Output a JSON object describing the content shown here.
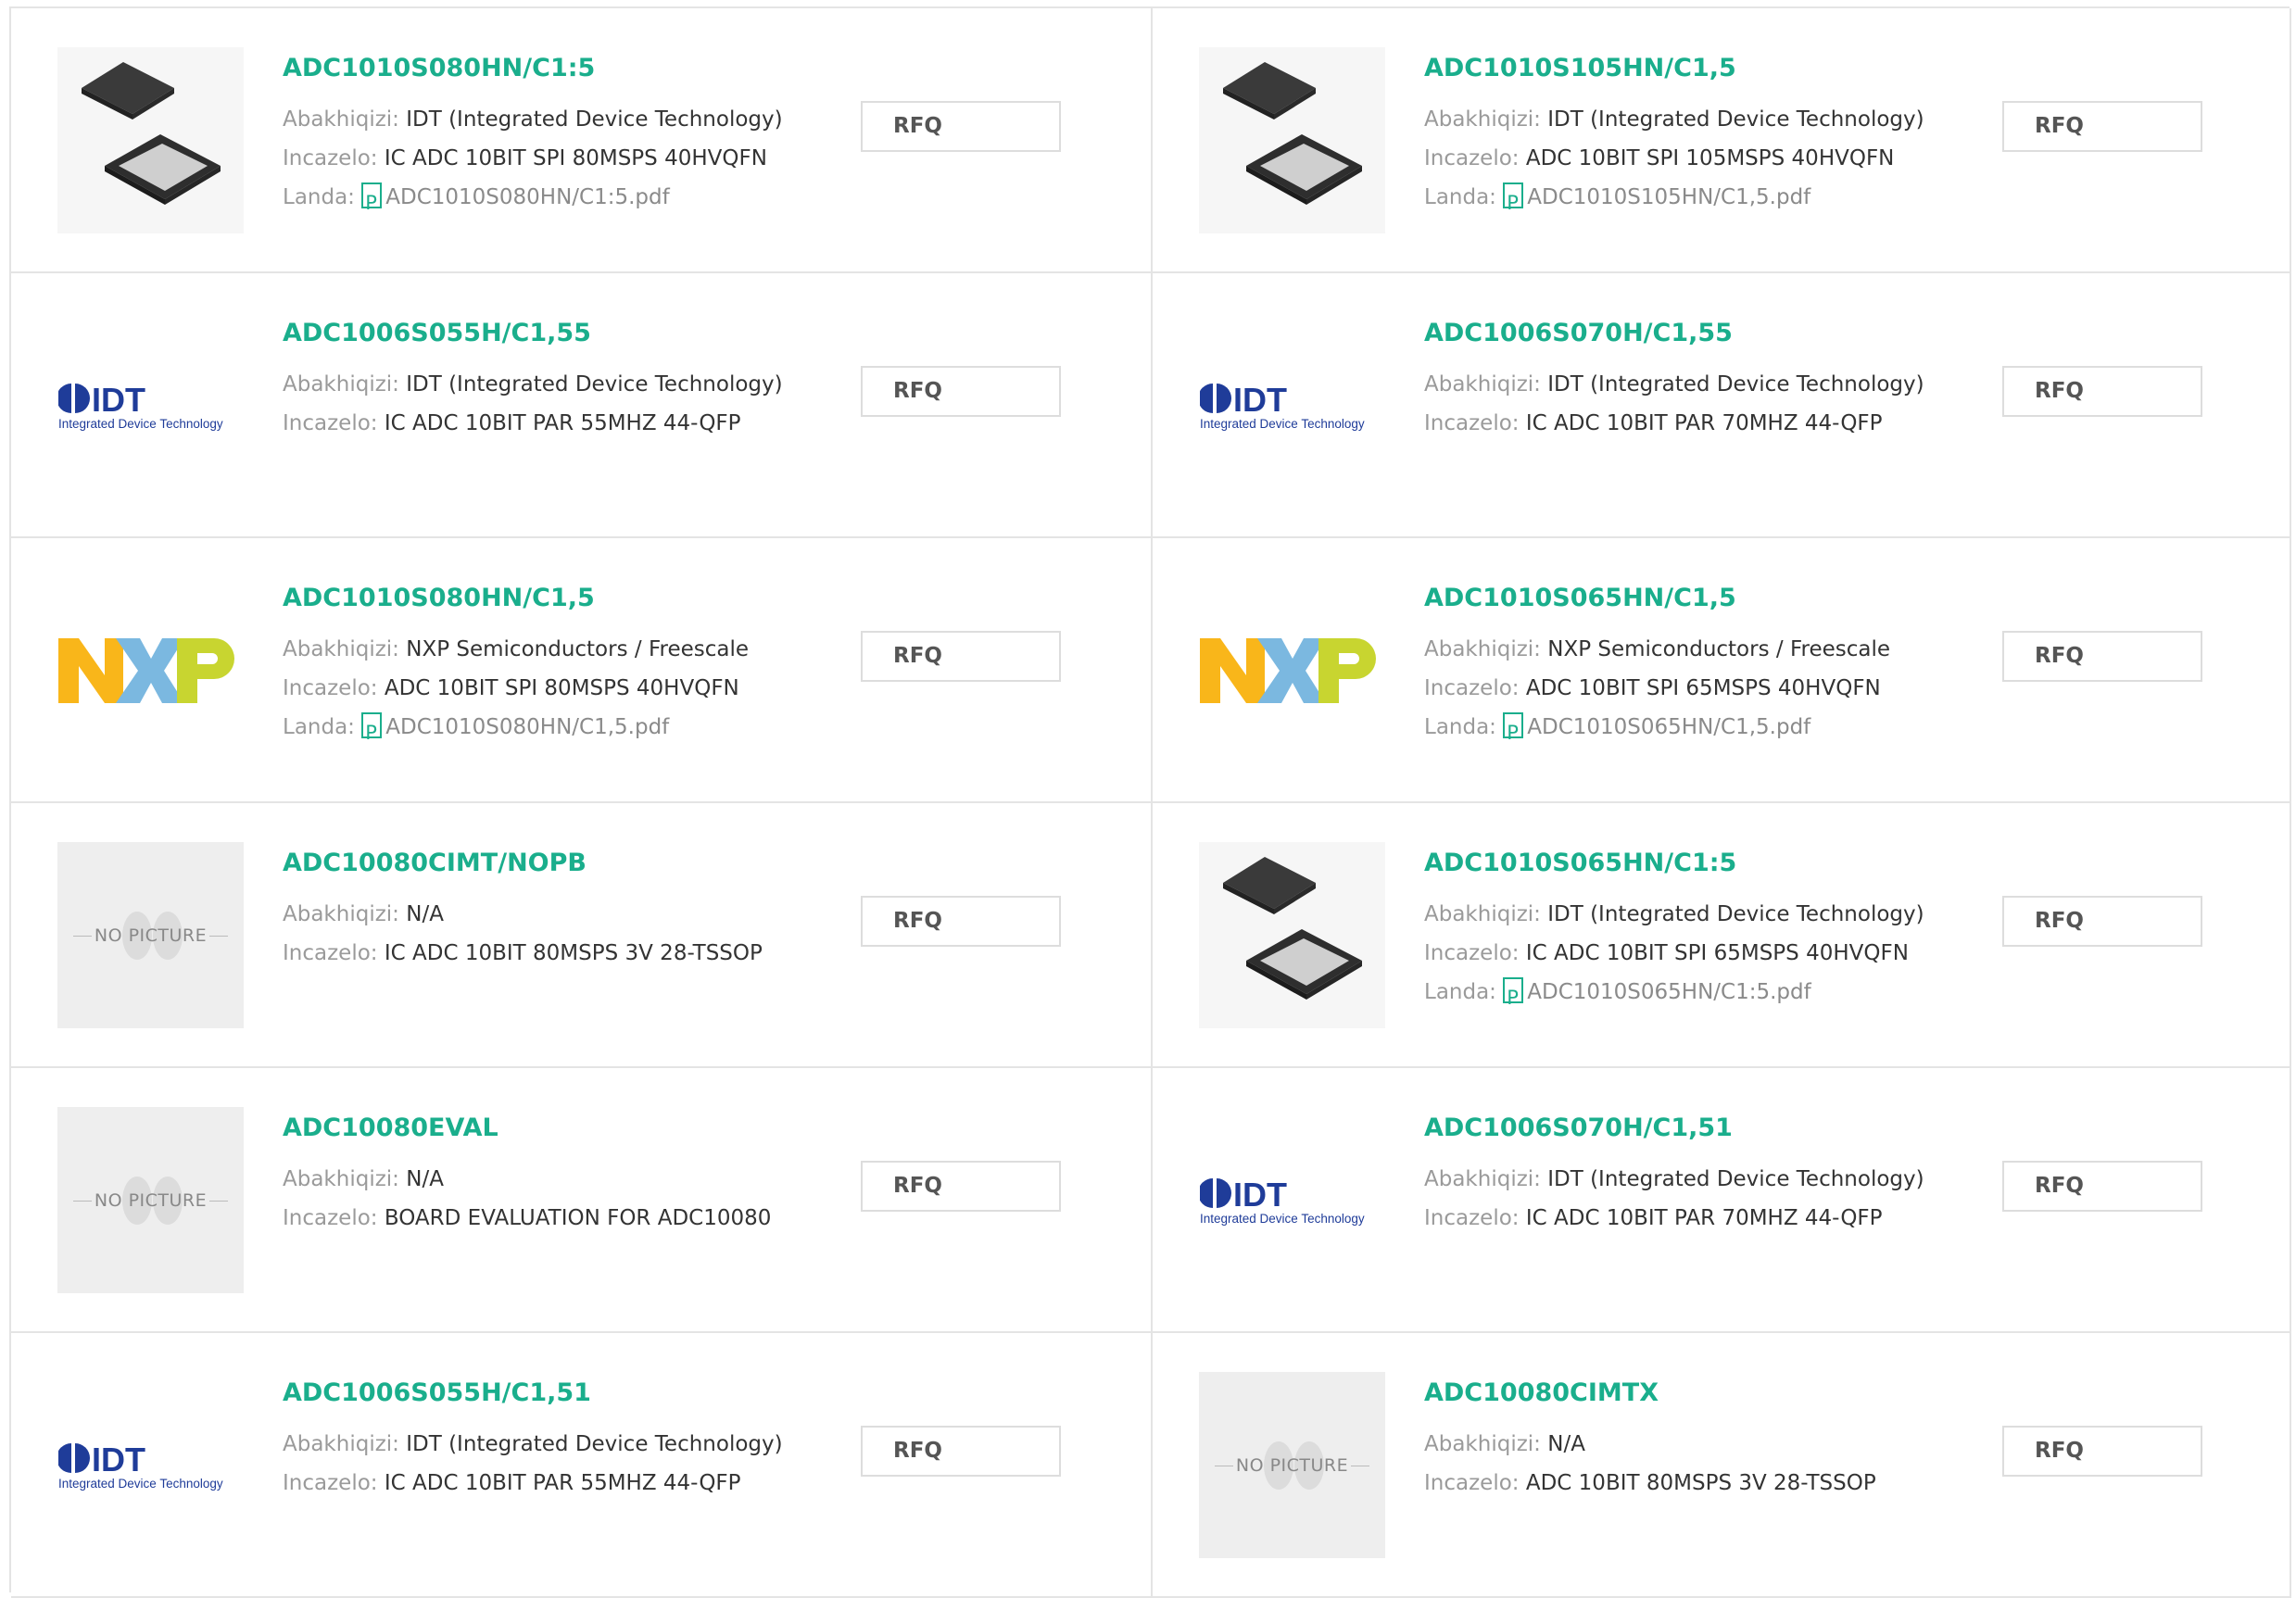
{
  "labels": {
    "manufacturer": "Abakhiqizi:",
    "description": "Incazelo:",
    "datasheet": "Landa:"
  },
  "rfq_label": "RFQ",
  "nopic_label": "NO PICTURE",
  "logo": {
    "idt_text": "IDT",
    "idt_sub": "Integrated Device Technology"
  },
  "colors": {
    "accent": "#1aae8c",
    "nxp_orange": "#f9b61a",
    "nxp_blue": "#7bb8e0",
    "nxp_green": "#c8d530",
    "idt_blue": "#1f3c99"
  },
  "products": [
    {
      "part": "ADC1010S080HN/C1:5",
      "manufacturer": "IDT (Integrated Device Technology)",
      "description": "IC ADC 10BIT SPI 80MSPS 40HVQFN",
      "datasheet": "ADC1010S080HN/C1:5.pdf",
      "image": "chip-photo"
    },
    {
      "part": "ADC1010S105HN/C1,5",
      "manufacturer": "IDT (Integrated Device Technology)",
      "description": "ADC 10BIT SPI 105MSPS 40HVQFN",
      "datasheet": "ADC1010S105HN/C1,5.pdf",
      "image": "chip-photo"
    },
    {
      "part": "ADC1006S055H/C1,55",
      "manufacturer": "IDT (Integrated Device Technology)",
      "description": "IC ADC 10BIT PAR 55MHZ 44-QFP",
      "datasheet": "",
      "image": "idt-logo"
    },
    {
      "part": "ADC1006S070H/C1,55",
      "manufacturer": "IDT (Integrated Device Technology)",
      "description": "IC ADC 10BIT PAR 70MHZ 44-QFP",
      "datasheet": "",
      "image": "idt-logo"
    },
    {
      "part": "ADC1010S080HN/C1,5",
      "manufacturer": "NXP Semiconductors / Freescale",
      "description": "ADC 10BIT SPI 80MSPS 40HVQFN",
      "datasheet": "ADC1010S080HN/C1,5.pdf",
      "image": "nxp-logo"
    },
    {
      "part": "ADC1010S065HN/C1,5",
      "manufacturer": "NXP Semiconductors / Freescale",
      "description": "ADC 10BIT SPI 65MSPS 40HVQFN",
      "datasheet": "ADC1010S065HN/C1,5.pdf",
      "image": "nxp-logo"
    },
    {
      "part": "ADC10080CIMT/NOPB",
      "manufacturer": "N/A",
      "description": "IC ADC 10BIT 80MSPS 3V 28-TSSOP",
      "datasheet": "",
      "image": "no-picture"
    },
    {
      "part": "ADC1010S065HN/C1:5",
      "manufacturer": "IDT (Integrated Device Technology)",
      "description": "IC ADC 10BIT SPI 65MSPS 40HVQFN",
      "datasheet": "ADC1010S065HN/C1:5.pdf",
      "image": "chip-photo"
    },
    {
      "part": "ADC10080EVAL",
      "manufacturer": "N/A",
      "description": "BOARD EVALUATION FOR ADC10080",
      "datasheet": "",
      "image": "no-picture"
    },
    {
      "part": "ADC1006S070H/C1,51",
      "manufacturer": "IDT (Integrated Device Technology)",
      "description": "IC ADC 10BIT PAR 70MHZ 44-QFP",
      "datasheet": "",
      "image": "idt-logo"
    },
    {
      "part": "ADC1006S055H/C1,51",
      "manufacturer": "IDT (Integrated Device Technology)",
      "description": "IC ADC 10BIT PAR 55MHZ 44-QFP",
      "datasheet": "",
      "image": "idt-logo"
    },
    {
      "part": "ADC10080CIMTX",
      "manufacturer": "N/A",
      "description": "ADC 10BIT 80MSPS 3V 28-TSSOP",
      "datasheet": "",
      "image": "no-picture"
    }
  ]
}
